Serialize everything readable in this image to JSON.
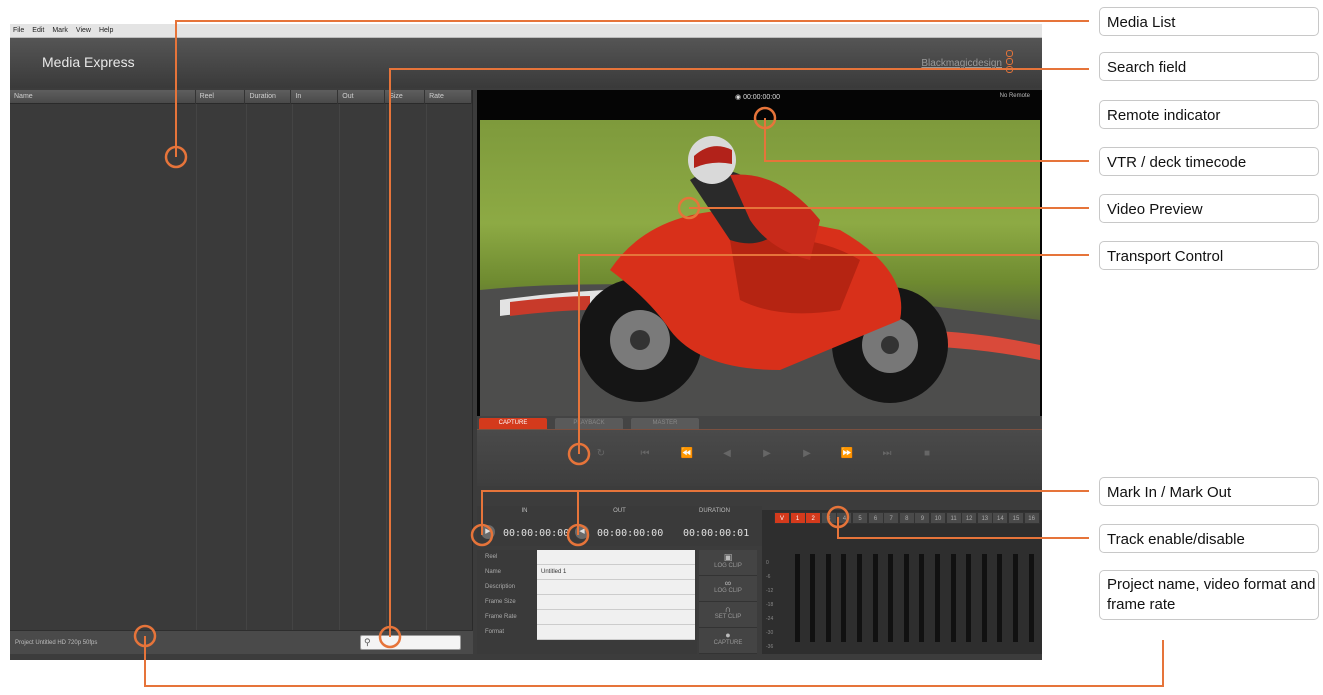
{
  "menu": [
    "File",
    "Edit",
    "Mark",
    "View",
    "Help"
  ],
  "app": {
    "title": "Media Express",
    "brand": "Blackmagicdesign"
  },
  "media_list": {
    "columns": [
      "Name",
      "Reel",
      "Duration",
      "In",
      "Out",
      "Size",
      "Rate"
    ]
  },
  "status": {
    "project": "Project Untitled  HD 720p 50fps",
    "search_placeholder": ""
  },
  "preview": {
    "deck_timecode": "00:00:00:00",
    "remote": "No Remote"
  },
  "tabs": [
    "CAPTURE",
    "PLAYBACK",
    "MASTER"
  ],
  "io": {
    "in_label": "IN",
    "out_label": "OUT",
    "duration_label": "DURATION",
    "in_value": "00:00:00:00",
    "out_value": "00:00:00:00",
    "duration_value": "00:00:00:01"
  },
  "metadata": {
    "rows": [
      {
        "label": "Reel",
        "value": ""
      },
      {
        "label": "Name",
        "value": "Untitled 1"
      },
      {
        "label": "Description",
        "value": ""
      },
      {
        "label": "Frame Size",
        "value": ""
      },
      {
        "label": "Frame Rate",
        "value": ""
      },
      {
        "label": "Format",
        "value": ""
      }
    ]
  },
  "side_buttons": [
    {
      "label": "LOG CLIP",
      "icon": "camera-icon"
    },
    {
      "label": "LOG CLIP",
      "icon": "link-icon"
    },
    {
      "label": "SET CLIP",
      "icon": "magnet-icon"
    },
    {
      "label": "CAPTURE",
      "icon": "record-icon"
    }
  ],
  "tracks": [
    "V",
    "1",
    "2",
    "3",
    "4",
    "5",
    "6",
    "7",
    "8",
    "9",
    "10",
    "11",
    "12",
    "13",
    "14",
    "15",
    "16"
  ],
  "meter_scale": [
    "0",
    "-6",
    "-12",
    "-18",
    "-24",
    "-30",
    "-36"
  ],
  "callouts": {
    "media_list": "Media List",
    "search_field": "Search field",
    "remote_indicator": "Remote indicator",
    "deck_timecode": "VTR / deck timecode",
    "video_preview": "Video Preview",
    "transport_control": "Transport Control",
    "mark_in_out": "Mark In / Mark Out",
    "track_enable": "Track enable/disable",
    "project_name": "Project name, video format and frame rate"
  },
  "colors": {
    "accent": "#e6743a",
    "capture_tab": "#d43a1c"
  }
}
